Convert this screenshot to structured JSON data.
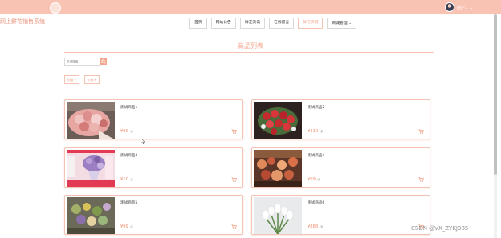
{
  "header": {
    "site_title": "网上鲜花销售系统",
    "user_name": "用户1",
    "user_caret": "⌄"
  },
  "nav": {
    "items": [
      {
        "label": "首页"
      },
      {
        "label": "网站公告"
      },
      {
        "label": "鲜花资讯"
      },
      {
        "label": "在线留言"
      },
      {
        "label": "鲜花商城"
      },
      {
        "label": "商城管理"
      }
    ],
    "active_index": 4
  },
  "main": {
    "heading": "商品列表",
    "search_placeholder": "花语搜索",
    "sort_buttons": [
      {
        "label": "销量 ▾"
      },
      {
        "label": "价格 ▾"
      }
    ]
  },
  "products": [
    {
      "name": "测试商品1",
      "price": "¥99",
      "unit": "/束",
      "image": "pink-bouquet"
    },
    {
      "name": "测试商品2",
      "price": "¥110",
      "unit": "/束",
      "image": "red-roses"
    },
    {
      "name": "测试商品3",
      "price": "¥10",
      "unit": "/束",
      "image": "purple-bouquet-ad"
    },
    {
      "name": "测试商品4",
      "price": "¥99",
      "unit": "/束",
      "image": "flower-shop"
    },
    {
      "name": "测试商品5",
      "price": "¥99",
      "unit": "/束",
      "image": "mixed-flowers"
    },
    {
      "name": "测试商品6",
      "price": "¥888",
      "unit": "/束",
      "image": "white-tulips"
    }
  ],
  "watermark": "CSDN @VX_ZYKJ985",
  "colors": {
    "accent": "#f3a58d",
    "topbar": "#f9c3b3",
    "price": "#f08a6a"
  }
}
